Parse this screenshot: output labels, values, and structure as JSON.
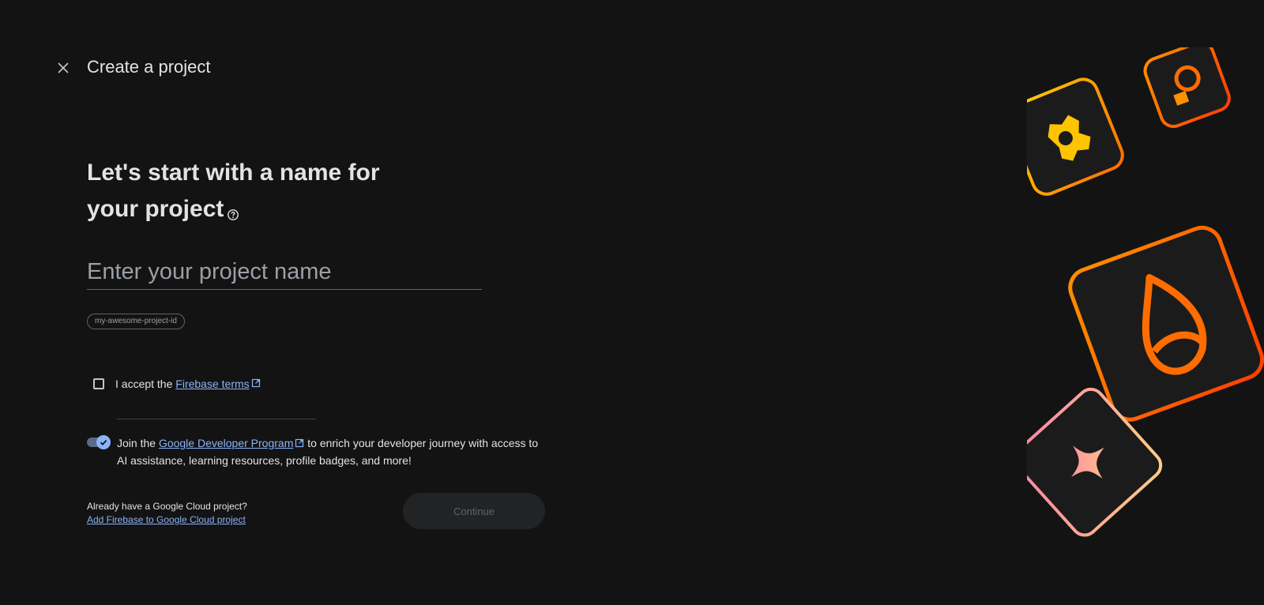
{
  "header": {
    "title": "Create a project",
    "close_icon": "close-icon"
  },
  "main": {
    "headline": "Let's start with a name for your project",
    "help_icon": "help-circle-icon",
    "name_input": {
      "placeholder": "Enter your project name",
      "value": ""
    },
    "project_id": "my-awesome-project-id",
    "terms": {
      "checked": false,
      "prefix": "I accept the ",
      "link_text": "Firebase terms"
    },
    "gdp": {
      "enabled": true,
      "prefix": "Join the ",
      "link_text": "Google Developer Program",
      "suffix": " to enrich your developer journey with access to AI assistance, learning resources, profile badges, and more!"
    },
    "cloud": {
      "question": "Already have a Google Cloud project?",
      "link_text": "Add Firebase to Google Cloud project"
    },
    "continue_label": "Continue"
  },
  "colors": {
    "background": "#131314",
    "link": "#8ab4f8",
    "accent_orange": "#ff6d00",
    "accent_yellow": "#ffc400"
  }
}
